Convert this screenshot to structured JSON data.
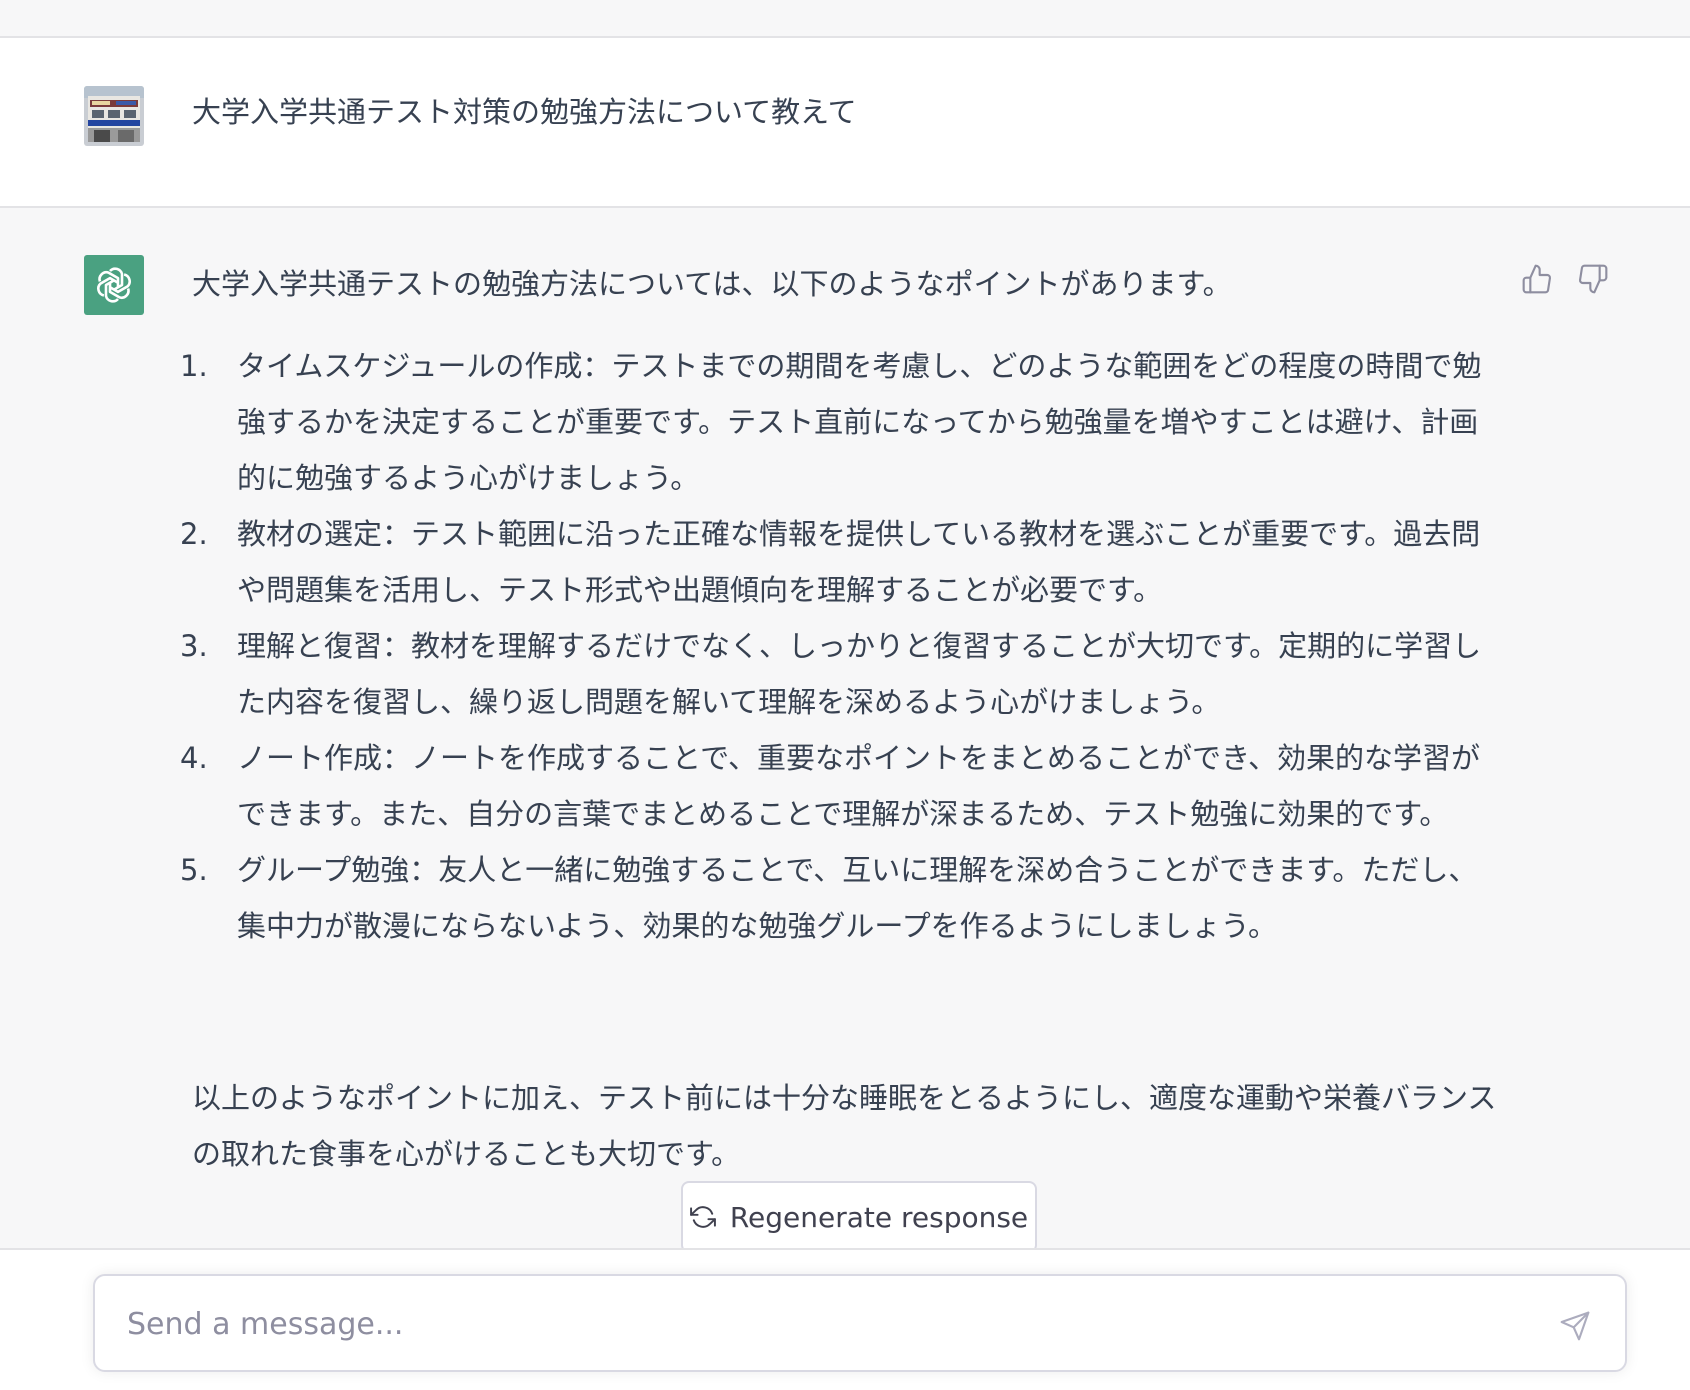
{
  "user_message": {
    "avatar_icon": "user-avatar-photo",
    "text": "大学入学共通テスト対策の勉強方法について教えて"
  },
  "assistant_message": {
    "avatar_icon": "openai-logo-icon",
    "intro": "大学入学共通テストの勉強方法については、以下のようなポイントがあります。",
    "items": [
      {
        "number": "1.",
        "text": "タイムスケジュールの作成：テストまでの期間を考慮し、どのような範囲をどの程度の時間で勉強するかを決定することが重要です。テスト直前になってから勉強量を増やすことは避け、計画的に勉強するよう心がけましょう。"
      },
      {
        "number": "2.",
        "text": "教材の選定：テスト範囲に沿った正確な情報を提供している教材を選ぶことが重要です。過去問や問題集を活用し、テスト形式や出題傾向を理解することが必要です。"
      },
      {
        "number": "3.",
        "text": "理解と復習：教材を理解するだけでなく、しっかりと復習することが大切です。定期的に学習した内容を復習し、繰り返し問題を解いて理解を深めるよう心がけましょう。"
      },
      {
        "number": "4.",
        "text": "ノート作成：ノートを作成することで、重要なポイントをまとめることができ、効果的な学習ができます。また、自分の言葉でまとめることで理解が深まるため、テスト勉強に効果的です。"
      },
      {
        "number": "5.",
        "text": "グループ勉強：友人と一緒に勉強することで、互いに理解を深め合うことができます。ただし、集中力が散漫にならないよう、効果的な勉強グループを作るようにしましょう。"
      }
    ],
    "closing": "以上のようなポイントに加え、テスト前には十分な睡眠をとるようにし、適度な運動や栄養バランスの取れた食事を心がけることも大切です。",
    "feedback": {
      "up_icon": "thumbs-up-icon",
      "down_icon": "thumbs-down-icon"
    }
  },
  "regenerate": {
    "icon": "refresh-icon",
    "label": "Regenerate response"
  },
  "composer": {
    "placeholder": "Send a message...",
    "value": "",
    "send_icon": "send-icon"
  },
  "colors": {
    "assistant_bg": "#f7f7f8",
    "user_bg": "#ffffff",
    "bot_avatar": "#4aa181",
    "text": "#374151",
    "border": "#d9d9e3"
  }
}
